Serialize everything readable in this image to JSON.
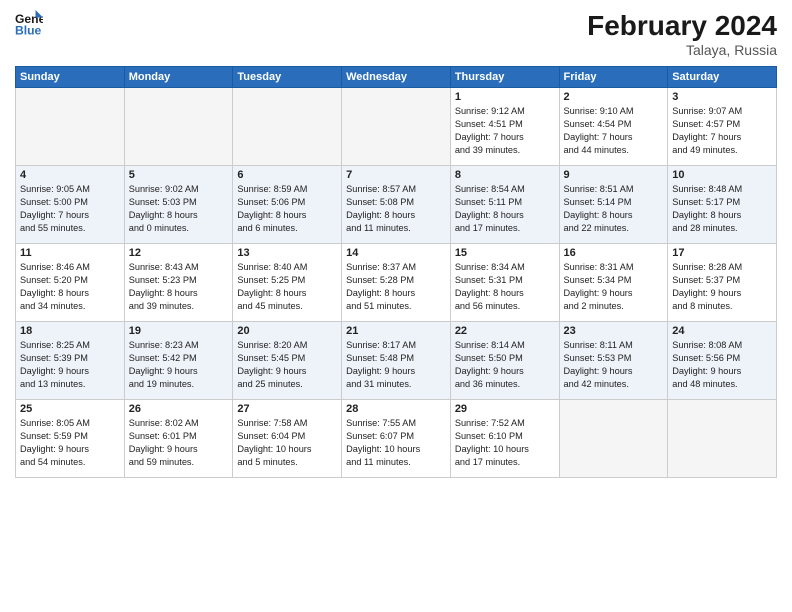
{
  "header": {
    "logo_line1": "General",
    "logo_line2": "Blue",
    "month": "February 2024",
    "location": "Talaya, Russia"
  },
  "weekdays": [
    "Sunday",
    "Monday",
    "Tuesday",
    "Wednesday",
    "Thursday",
    "Friday",
    "Saturday"
  ],
  "weeks": [
    [
      {
        "day": "",
        "info": ""
      },
      {
        "day": "",
        "info": ""
      },
      {
        "day": "",
        "info": ""
      },
      {
        "day": "",
        "info": ""
      },
      {
        "day": "1",
        "info": "Sunrise: 9:12 AM\nSunset: 4:51 PM\nDaylight: 7 hours\nand 39 minutes."
      },
      {
        "day": "2",
        "info": "Sunrise: 9:10 AM\nSunset: 4:54 PM\nDaylight: 7 hours\nand 44 minutes."
      },
      {
        "day": "3",
        "info": "Sunrise: 9:07 AM\nSunset: 4:57 PM\nDaylight: 7 hours\nand 49 minutes."
      }
    ],
    [
      {
        "day": "4",
        "info": "Sunrise: 9:05 AM\nSunset: 5:00 PM\nDaylight: 7 hours\nand 55 minutes."
      },
      {
        "day": "5",
        "info": "Sunrise: 9:02 AM\nSunset: 5:03 PM\nDaylight: 8 hours\nand 0 minutes."
      },
      {
        "day": "6",
        "info": "Sunrise: 8:59 AM\nSunset: 5:06 PM\nDaylight: 8 hours\nand 6 minutes."
      },
      {
        "day": "7",
        "info": "Sunrise: 8:57 AM\nSunset: 5:08 PM\nDaylight: 8 hours\nand 11 minutes."
      },
      {
        "day": "8",
        "info": "Sunrise: 8:54 AM\nSunset: 5:11 PM\nDaylight: 8 hours\nand 17 minutes."
      },
      {
        "day": "9",
        "info": "Sunrise: 8:51 AM\nSunset: 5:14 PM\nDaylight: 8 hours\nand 22 minutes."
      },
      {
        "day": "10",
        "info": "Sunrise: 8:48 AM\nSunset: 5:17 PM\nDaylight: 8 hours\nand 28 minutes."
      }
    ],
    [
      {
        "day": "11",
        "info": "Sunrise: 8:46 AM\nSunset: 5:20 PM\nDaylight: 8 hours\nand 34 minutes."
      },
      {
        "day": "12",
        "info": "Sunrise: 8:43 AM\nSunset: 5:23 PM\nDaylight: 8 hours\nand 39 minutes."
      },
      {
        "day": "13",
        "info": "Sunrise: 8:40 AM\nSunset: 5:25 PM\nDaylight: 8 hours\nand 45 minutes."
      },
      {
        "day": "14",
        "info": "Sunrise: 8:37 AM\nSunset: 5:28 PM\nDaylight: 8 hours\nand 51 minutes."
      },
      {
        "day": "15",
        "info": "Sunrise: 8:34 AM\nSunset: 5:31 PM\nDaylight: 8 hours\nand 56 minutes."
      },
      {
        "day": "16",
        "info": "Sunrise: 8:31 AM\nSunset: 5:34 PM\nDaylight: 9 hours\nand 2 minutes."
      },
      {
        "day": "17",
        "info": "Sunrise: 8:28 AM\nSunset: 5:37 PM\nDaylight: 9 hours\nand 8 minutes."
      }
    ],
    [
      {
        "day": "18",
        "info": "Sunrise: 8:25 AM\nSunset: 5:39 PM\nDaylight: 9 hours\nand 13 minutes."
      },
      {
        "day": "19",
        "info": "Sunrise: 8:23 AM\nSunset: 5:42 PM\nDaylight: 9 hours\nand 19 minutes."
      },
      {
        "day": "20",
        "info": "Sunrise: 8:20 AM\nSunset: 5:45 PM\nDaylight: 9 hours\nand 25 minutes."
      },
      {
        "day": "21",
        "info": "Sunrise: 8:17 AM\nSunset: 5:48 PM\nDaylight: 9 hours\nand 31 minutes."
      },
      {
        "day": "22",
        "info": "Sunrise: 8:14 AM\nSunset: 5:50 PM\nDaylight: 9 hours\nand 36 minutes."
      },
      {
        "day": "23",
        "info": "Sunrise: 8:11 AM\nSunset: 5:53 PM\nDaylight: 9 hours\nand 42 minutes."
      },
      {
        "day": "24",
        "info": "Sunrise: 8:08 AM\nSunset: 5:56 PM\nDaylight: 9 hours\nand 48 minutes."
      }
    ],
    [
      {
        "day": "25",
        "info": "Sunrise: 8:05 AM\nSunset: 5:59 PM\nDaylight: 9 hours\nand 54 minutes."
      },
      {
        "day": "26",
        "info": "Sunrise: 8:02 AM\nSunset: 6:01 PM\nDaylight: 9 hours\nand 59 minutes."
      },
      {
        "day": "27",
        "info": "Sunrise: 7:58 AM\nSunset: 6:04 PM\nDaylight: 10 hours\nand 5 minutes."
      },
      {
        "day": "28",
        "info": "Sunrise: 7:55 AM\nSunset: 6:07 PM\nDaylight: 10 hours\nand 11 minutes."
      },
      {
        "day": "29",
        "info": "Sunrise: 7:52 AM\nSunset: 6:10 PM\nDaylight: 10 hours\nand 17 minutes."
      },
      {
        "day": "",
        "info": ""
      },
      {
        "day": "",
        "info": ""
      }
    ]
  ]
}
